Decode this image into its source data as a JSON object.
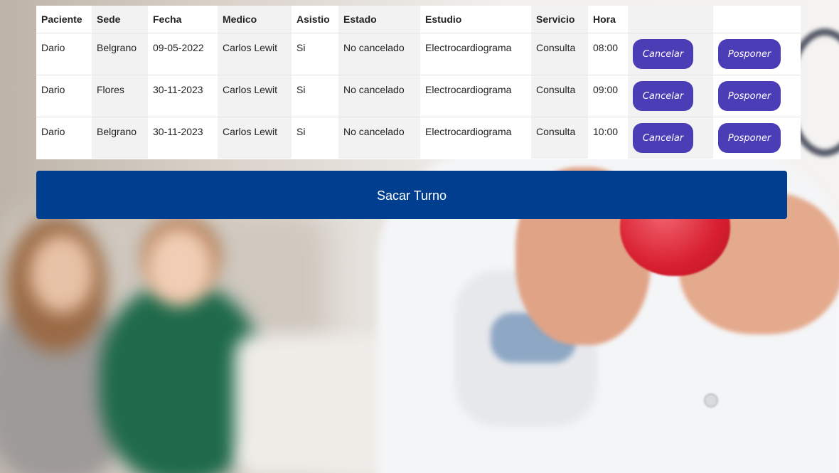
{
  "table": {
    "headers": [
      "Paciente",
      "Sede",
      "Fecha",
      "Medico",
      "Asistio",
      "Estado",
      "Estudio",
      "Servicio",
      "Hora",
      "",
      ""
    ],
    "rows": [
      {
        "paciente": "Dario",
        "sede": "Belgrano",
        "fecha": "09-05-2022",
        "medico": "Carlos Lewit",
        "asistio": "Si",
        "estado": "No cancelado",
        "estudio": "Electrocardiograma",
        "servicio": "Consulta",
        "hora": "08:00"
      },
      {
        "paciente": "Dario",
        "sede": "Flores",
        "fecha": "30-11-2023",
        "medico": "Carlos Lewit",
        "asistio": "Si",
        "estado": "No cancelado",
        "estudio": "Electrocardiograma",
        "servicio": "Consulta",
        "hora": "09:00"
      },
      {
        "paciente": "Dario",
        "sede": "Belgrano",
        "fecha": "30-11-2023",
        "medico": "Carlos Lewit",
        "asistio": "Si",
        "estado": "No cancelado",
        "estudio": "Electrocardiograma",
        "servicio": "Consulta",
        "hora": "10:00"
      }
    ],
    "cancel_label": "Cancelar",
    "postpone_label": "Posponer"
  },
  "main_button": {
    "label": "Sacar Turno"
  },
  "colors": {
    "action_button": "#4a3db6",
    "primary_button": "#003f8f"
  }
}
